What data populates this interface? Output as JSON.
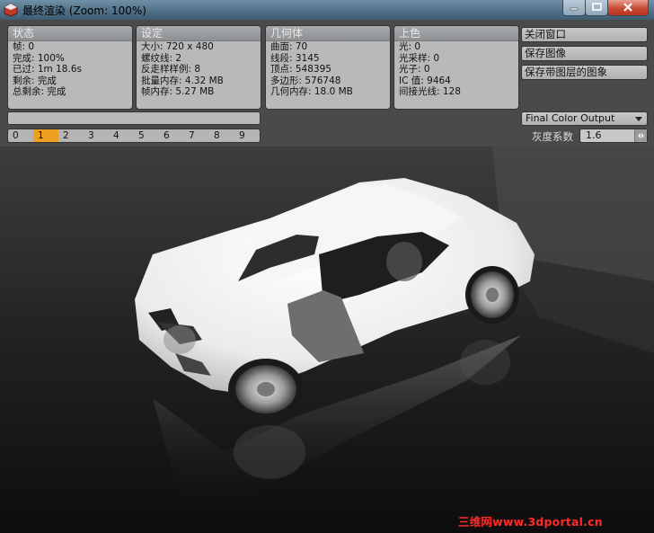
{
  "window": {
    "title": "最终渲染 (Zoom: 100%)"
  },
  "status": {
    "header": "状态",
    "rows": [
      "帧: 0",
      "完成: 100%",
      "已过: 1m 18.6s",
      "剩余: 完成",
      "总剩余: 完成"
    ]
  },
  "settings": {
    "header": "设定",
    "rows": [
      "大小: 720 x 480",
      "螺纹线: 2",
      "反走样样例: 8",
      "批量内存: 4.32 MB",
      "帧内存: 5.27 MB"
    ]
  },
  "geometry": {
    "header": "几何体",
    "rows": [
      "曲面: 70",
      "线段: 3145",
      "顶点: 548395",
      "多边形: 576748",
      "几何内存: 18.0 MB"
    ]
  },
  "shading": {
    "header": "上色",
    "rows": [
      "光: 0",
      "光采样: 0",
      "光子: 0",
      "IC 值: 9464",
      "间接光线: 128"
    ]
  },
  "actions": {
    "close_window": "关闭窗口",
    "save_image": "保存图像",
    "save_layered": "保存带图层的图象"
  },
  "render_progress": 1.0,
  "frames": {
    "pages": [
      "0",
      "1",
      "2",
      "3",
      "4",
      "5",
      "6",
      "7",
      "8",
      "9"
    ],
    "active": "1"
  },
  "output": {
    "selected": "Final Color Output"
  },
  "gamma": {
    "label": "灰度系数",
    "value": "1.6"
  },
  "watermark": "三维网www.3dportal.cn",
  "icons": [
    "render-app-icon",
    "minimize-icon",
    "maximize-icon",
    "close-icon",
    "dropdown-arrow-icon",
    "spinner-icon"
  ],
  "colors": {
    "active_frame": "#f0a020",
    "close_button": "#c74a33",
    "watermark": "#ff2a2a"
  }
}
